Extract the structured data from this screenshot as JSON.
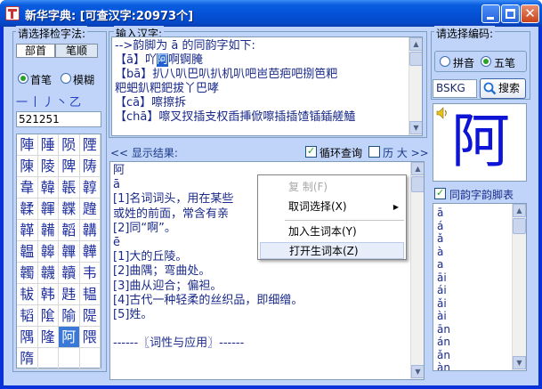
{
  "window": {
    "title": "新华字典: [可查汉字:20973个]"
  },
  "left": {
    "title": "请选择检字法:",
    "tabs": [
      {
        "label": "部首"
      },
      {
        "label": "笔顺"
      }
    ],
    "radios": [
      {
        "label": "首笔",
        "checked": true
      },
      {
        "label": "模糊",
        "checked": false
      }
    ],
    "strokes": "一丨丿丶乙",
    "stroke_code": "521251",
    "grid": [
      [
        "陣",
        "陲",
        "陨",
        "陻"
      ],
      [
        "陳",
        "陵",
        "陴",
        "陦"
      ],
      [
        "韋",
        "韓",
        "韔",
        "韕"
      ],
      [
        "韖",
        "韗",
        "韘",
        "韙"
      ],
      [
        "韚",
        "韛",
        "韜",
        "韝"
      ],
      [
        "韞",
        "韟",
        "韠",
        "韡"
      ],
      [
        "韣",
        "韤",
        "韥",
        "韦"
      ],
      [
        "韨",
        "韩",
        "韪",
        "韫"
      ],
      [
        "韬",
        "隂",
        "隃",
        "隄"
      ],
      [
        "隅",
        "隆",
        "阿",
        "隈"
      ],
      [
        "隋",
        "",
        "",
        ""
      ]
    ],
    "grid_selected": "阿"
  },
  "input": {
    "title": "输入汉字:",
    "lines": [
      "-->韵脚为 ā 的同韵字如下:",
      "【ā】吖阿啊锕腌",
      "【bā】扒八叭巴叭扒机叭吧岜芭疤吧捌笆粑",
      "粑蚆釟粑鈀拔丫巴哮",
      "【cā】嚓擦拆",
      "【chā】嚓叉扠插支权臿挿俽嚓插插馇锸鍤艖鰪"
    ],
    "highlight": "阿"
  },
  "results": {
    "title": "<< 显示结果:",
    "loop_label": "循环查询",
    "loop_checked": true,
    "history_label": "历 大 >>",
    "history_checked": false,
    "lines": [
      "阿",
      "ā",
      "[1]名词词头，用在某些",
      "或姓的前面，常含有亲",
      "[2]同“啊”。",
      "ē",
      "[1]大的丘陵。",
      "[2]曲隅；弯曲处。",
      "[3]曲从迎合；偏袒。",
      "[4]古代一种轻柔的丝织品，即细缯。",
      "[5]姓。",
      "",
      "------〖词性与应用〗------"
    ]
  },
  "context_menu": {
    "items": [
      {
        "label": "复 制(F)",
        "disabled": true
      },
      {
        "label": "取词选择(X)",
        "submenu": true
      },
      {
        "label": "加入生词本(Y)"
      },
      {
        "label": "打开生词本(Z)",
        "hover": true
      }
    ]
  },
  "right": {
    "title": "请选择编码:",
    "radios": [
      {
        "label": "拼音",
        "checked": false
      },
      {
        "label": "五笔",
        "checked": true
      }
    ],
    "code_value": "BSKG",
    "search_label": "搜索",
    "big_char": "阿",
    "rhyme_label": "同韵字韵脚表",
    "rhyme_checked": true,
    "rhyme_list": [
      "ā",
      "á",
      "ǎ",
      "à",
      "a",
      "āi",
      "ái",
      "ǎi",
      "ài",
      "ān",
      "án",
      "ǎn",
      "àn"
    ]
  },
  "colors": {
    "title_bar": "#0452d8",
    "client_bg": "#bfd4f8",
    "text_blue": "#1a2a8a",
    "big_char": "#0d14d6"
  }
}
